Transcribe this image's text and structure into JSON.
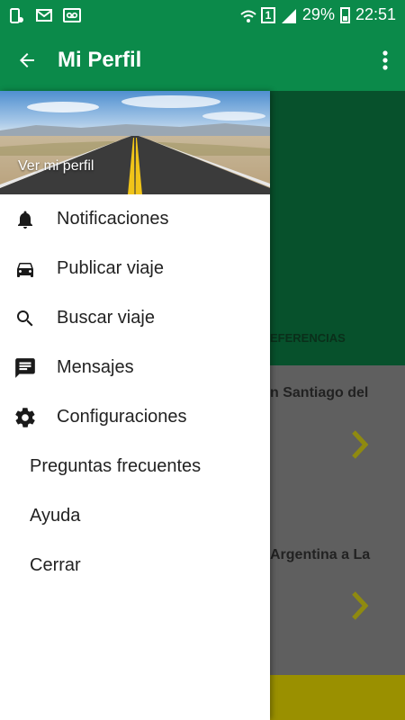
{
  "status_bar": {
    "battery_text": "29%",
    "time": "22:51",
    "sim_label": "1"
  },
  "app_bar": {
    "title": "Mi Perfil"
  },
  "drawer": {
    "header_link": "Ver mi perfil",
    "items": [
      {
        "label": "Notificaciones",
        "icon": "bell-icon"
      },
      {
        "label": "Publicar viaje",
        "icon": "car-icon"
      },
      {
        "label": "Buscar viaje",
        "icon": "search-icon"
      },
      {
        "label": "Mensajes",
        "icon": "message-icon"
      },
      {
        "label": "Configuraciones",
        "icon": "gear-icon"
      }
    ],
    "plain_items": [
      {
        "label": "Preguntas frecuentes"
      },
      {
        "label": "Ayuda"
      },
      {
        "label": "Cerrar"
      }
    ]
  },
  "background": {
    "section_label": "EFERENCIAS",
    "trips": [
      {
        "title": "n Santiago del"
      },
      {
        "title": "Argentina a La"
      }
    ]
  },
  "colors": {
    "primary": "#0b8a4a",
    "accent": "#c9bd00"
  }
}
